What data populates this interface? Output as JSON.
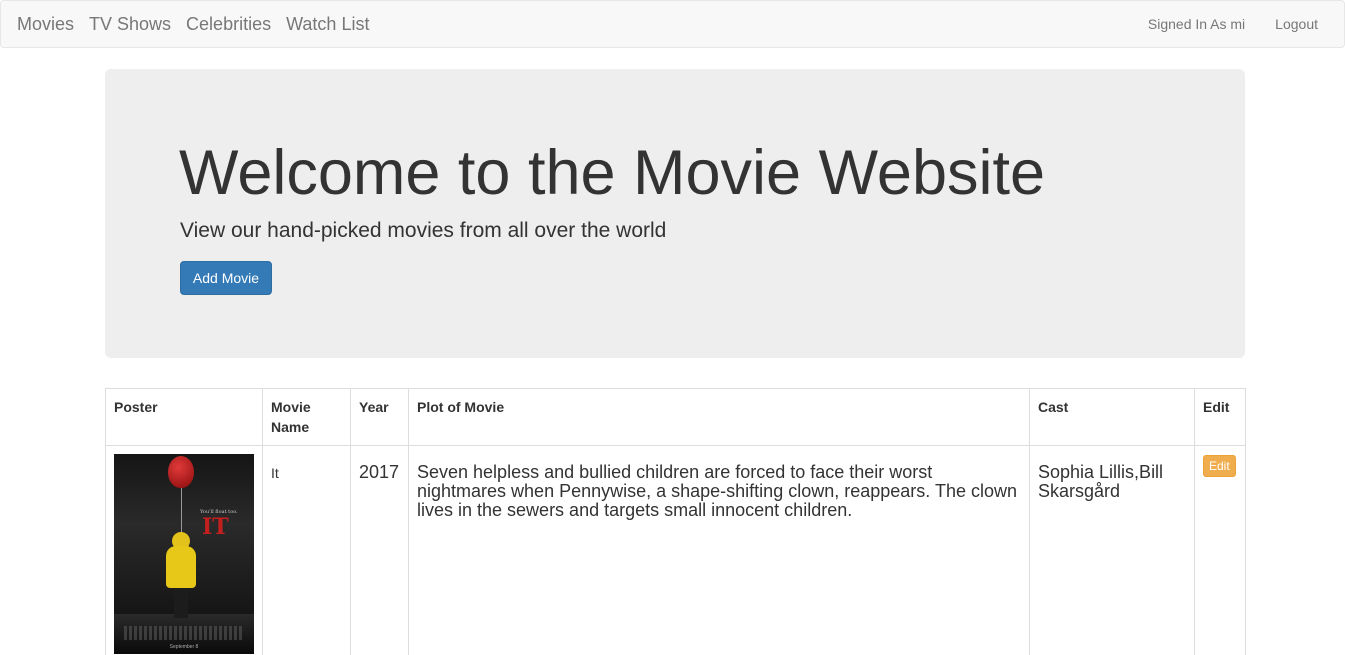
{
  "navbar": {
    "left_links": [
      "Movies",
      "TV Shows",
      "Celebrities",
      "Watch List"
    ],
    "signed_in_label": "Signed In As mi",
    "logout_label": "Logout"
  },
  "hero": {
    "title": "Welcome to the Movie Website",
    "subtitle": "View our hand-picked movies from all over the world",
    "add_movie_label": "Add Movie",
    "add_movie_color": "#337ab7"
  },
  "table": {
    "headers": {
      "poster": "Poster",
      "movie_name": "Movie Name",
      "year": "Year",
      "plot": "Plot of Movie",
      "cast": "Cast",
      "edit": "Edit"
    },
    "rows": [
      {
        "poster": {
          "tagline": "You'll float too.",
          "logo": "IT",
          "date": "September 8"
        },
        "movie_name": "It",
        "year": "2017",
        "plot": "Seven helpless and bullied children are forced to face their worst nightmares when Pennywise, a shape-shifting clown, reappears. The clown lives in the sewers and targets small innocent children.",
        "cast": "Sophia Lillis,Bill Skarsgård",
        "edit_label": "Edit",
        "edit_color": "#f0ad4e"
      }
    ]
  }
}
